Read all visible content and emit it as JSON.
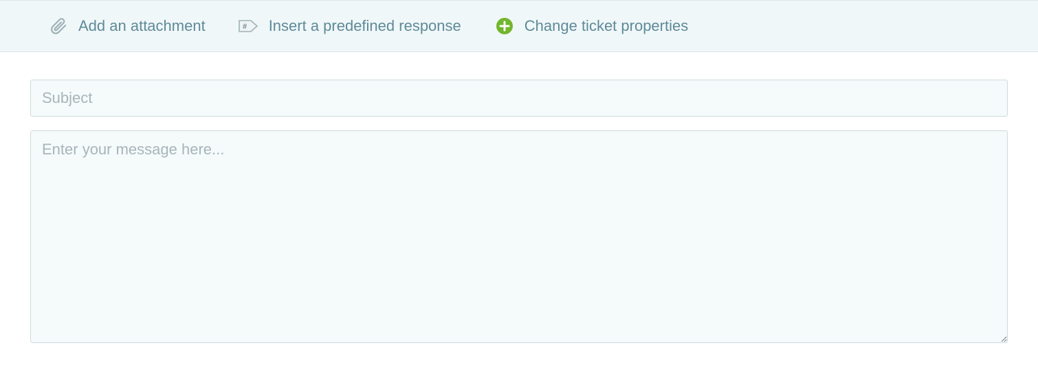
{
  "toolbar": {
    "attachment_label": "Add an attachment",
    "predefined_label": "Insert a predefined response",
    "properties_label": "Change ticket properties"
  },
  "form": {
    "subject_placeholder": "Subject",
    "subject_value": "",
    "message_placeholder": "Enter your message here...",
    "message_value": ""
  },
  "colors": {
    "toolbar_bg": "#f0f7f8",
    "link_text": "#5e8a99",
    "input_bg": "#f5fafb",
    "input_border": "#cfdadd",
    "plus_green": "#72b62c"
  }
}
